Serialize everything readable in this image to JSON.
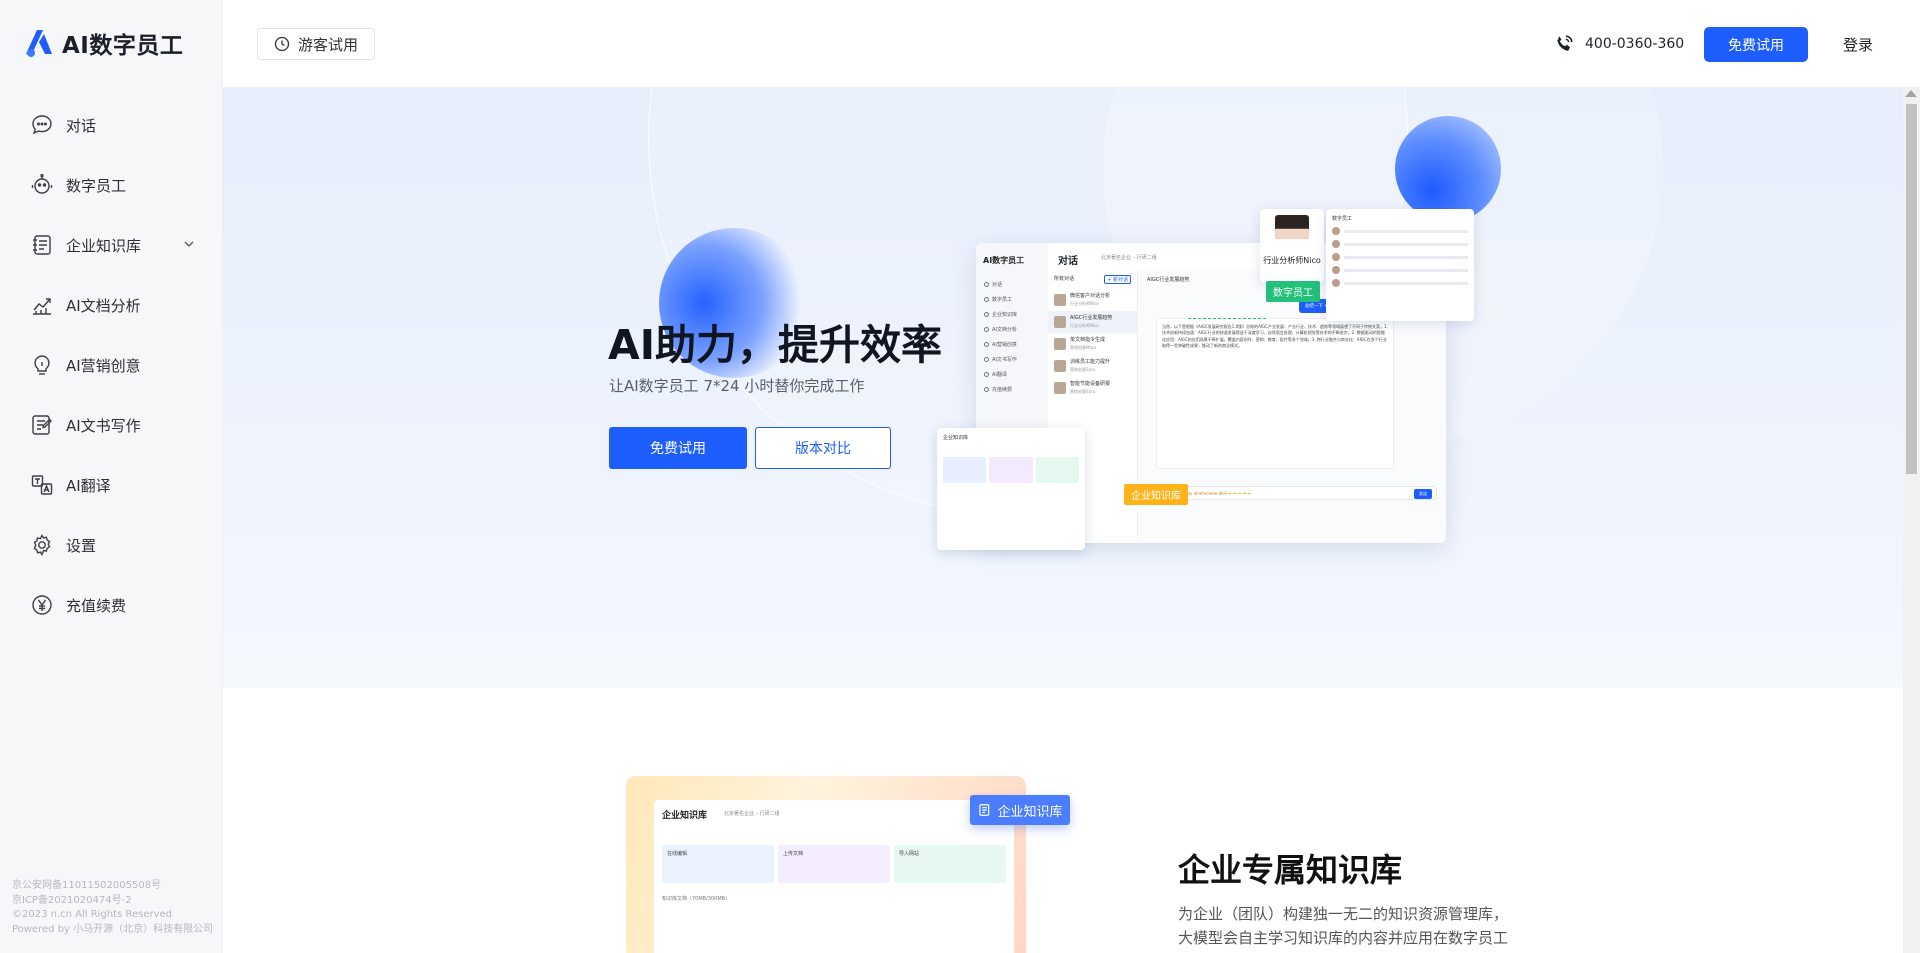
{
  "brand": {
    "name": "AI数字员工",
    "accent": "#1e5eff"
  },
  "sidebar": {
    "items": [
      {
        "label": "对话",
        "icon": "chat-bubble-icon"
      },
      {
        "label": "数字员工",
        "icon": "robot-icon"
      },
      {
        "label": "企业知识库",
        "icon": "knowledge-base-icon",
        "expandable": true
      },
      {
        "label": "AI文档分析",
        "icon": "chart-line-icon"
      },
      {
        "label": "AI营销创意",
        "icon": "lightbulb-icon"
      },
      {
        "label": "AI文书写作",
        "icon": "document-edit-icon"
      },
      {
        "label": "AI翻译",
        "icon": "translate-icon"
      },
      {
        "label": "设置",
        "icon": "gear-icon"
      },
      {
        "label": "充值续费",
        "icon": "yen-coin-icon"
      }
    ],
    "footer": [
      "京公安网备11011502005508号",
      "京ICP备2021020474号-2",
      "©2023 n.cn All Rights Reserved",
      "Powered by 小马开源（北京）科技有限公司"
    ]
  },
  "header": {
    "guest_trial": "游客试用",
    "phone": "400-0360-360",
    "free_trial": "免费试用",
    "login": "登录"
  },
  "hero": {
    "title": "AI助力，提升效率",
    "subtitle": "让AI数字员工 7*24 小时替你完成工作",
    "primary_button": "免费试用",
    "secondary_button": "版本对比"
  },
  "mockup": {
    "app_name": "AI数字员工",
    "title": "对话",
    "crumb": "北京著名企业 – 行研二组",
    "nav": [
      "对话",
      "数字员工",
      "企业知识库",
      "AI文档分析",
      "AI营销创意",
      "AI文书写作",
      "AI翻译",
      "充值续费"
    ],
    "list_header": "所有对话",
    "new_chat": "+ 新对话",
    "conversations": [
      {
        "title": "微信客户对话分析",
        "sub": "行业分析师Nico"
      },
      {
        "title": "AIGC行业发展趋势",
        "sub": "行业分析师Nico"
      },
      {
        "title": "单文档指令生成",
        "sub": "营销创意Mara"
      },
      {
        "title": "训练员工能力提升",
        "sub": "营销创意Sara"
      },
      {
        "title": "智能节能设备研报",
        "sub": "营销创意Sara"
      }
    ],
    "chat_head": "AIGC行业发展趋势",
    "question": "总结一下《AIGC发展研究报告1.0版》的主要趋势",
    "answer": "当然，以下是根据《AIGC发展研究报告1.0版》总结的AIGC产业发展：产业行业、技术、趋势等领域展望了不同于传统文案，1. 技术创新持续加速：AIGC行业的快速发展得益于深度学习、自然语言处理、计算机视觉等技术的不断进步。2. 数据驱动的智能化应用：AIGC的应用场景不断扩展，覆盖内容创作、营销、教育、医疗等多个领域。3. 跨行业融合与商业化：AIGC在多个行业取得一些突破性成果，推动了新的商业模式。",
    "input_placeholder": "输入问题，Enter发送，Shift+Enter 换行",
    "send": "发送",
    "employee_name": "行业分析师Nico",
    "employee_badge": "数字员工",
    "employee_panel_title": "数字员工",
    "kb_panel_title": "企业知识库",
    "kb_badge": "企业知识库"
  },
  "section2": {
    "badge": "企业知识库",
    "title": "企业专属知识库",
    "description": "为企业（团队）构建独一无二的知识资源管理库，大模型会自主学习知识库的内容并应用在数字员工提供的服",
    "kb_header": "企业知识库",
    "kb_crumb": "北京著名企业 – 行研二组",
    "tiles": [
      "在线编辑",
      "上传文档",
      "导入网站"
    ],
    "table_label": "知识库文档（70MB/300MB）"
  }
}
